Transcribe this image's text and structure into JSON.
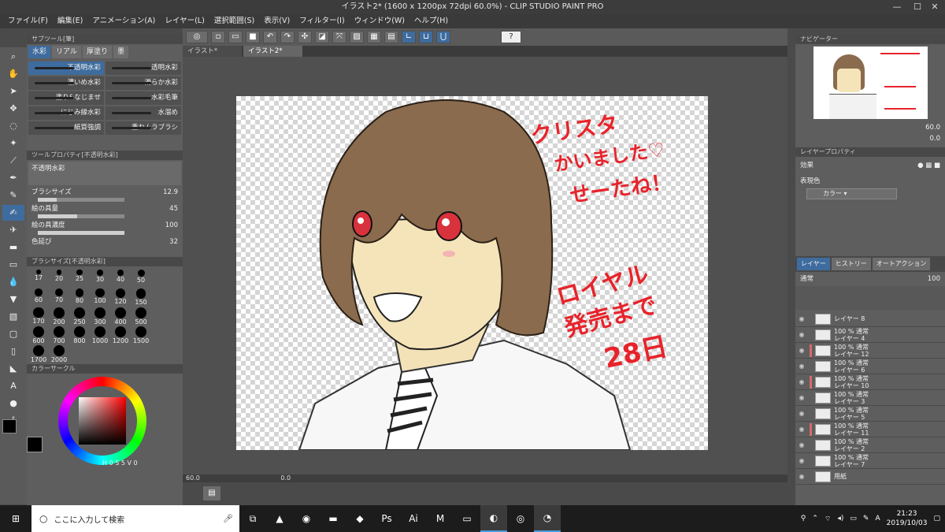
{
  "window": {
    "title": "イラスト2* (1600 x 1200px 72dpi 60.0%) - CLIP STUDIO PAINT PRO",
    "min": "—",
    "max": "☐",
    "close": "✕"
  },
  "menu": [
    "ファイル(F)",
    "編集(E)",
    "アニメーション(A)",
    "レイヤー(L)",
    "選択範囲(S)",
    "表示(V)",
    "フィルター(I)",
    "ウィンドウ(W)",
    "ヘルプ(H)"
  ],
  "toolbar": {
    "help": "?"
  },
  "subtool": {
    "header": "サブツール[筆]",
    "tabs": [
      "水彩",
      "リアル",
      "厚塗り",
      "墨"
    ],
    "brushes": [
      [
        "不透明水彩",
        "透明水彩"
      ],
      [
        "濃いめ水彩",
        "滑らか水彩"
      ],
      [
        "塗り&なじませ",
        "水彩毛筆"
      ],
      [
        "にじみ縁水彩",
        "水溜め"
      ],
      [
        "紙質強調",
        "重ねムラブラシ"
      ]
    ]
  },
  "toolprop": {
    "header": "ツールプロパティ[不透明水彩]",
    "name": "不透明水彩",
    "props": [
      {
        "label": "ブラシサイズ",
        "value": "12.9",
        "fill": 0.22
      },
      {
        "label": "絵の具量",
        "value": "45",
        "fill": 0.45
      },
      {
        "label": "絵の具濃度",
        "value": "100",
        "fill": 1.0
      },
      {
        "label": "色延び",
        "value": "32",
        "fill": 0.32
      }
    ]
  },
  "brushsize": {
    "header": "ブラシサイズ[不透明水彩]",
    "sizes": [
      "17",
      "20",
      "25",
      "30",
      "40",
      "50",
      "60",
      "70",
      "80",
      "100",
      "120",
      "150",
      "170",
      "200",
      "250",
      "300",
      "400",
      "500",
      "600",
      "700",
      "800",
      "1000",
      "1200",
      "1500",
      "1700",
      "2000"
    ]
  },
  "colorcircle": {
    "header": "カラーサークル",
    "readout": [
      "H",
      "0",
      "S",
      "5",
      "V",
      "0"
    ]
  },
  "doctabs": [
    "イラスト*",
    "イラスト2*"
  ],
  "status": {
    "zoom": "60.0",
    "angle": "0.0"
  },
  "navigator": {
    "header": "ナビゲーター",
    "zoom": "60.0",
    "angle": "0.0"
  },
  "layerprop": {
    "header": "レイヤープロパティ",
    "effect": "効果",
    "expr": "表現色",
    "color_mode": "カラー"
  },
  "layers": {
    "tabs": [
      "レイヤー",
      "ヒストリー",
      "オートアクション"
    ],
    "blend": "通常",
    "opacity": "100",
    "items": [
      {
        "mode": "",
        "name": "レイヤー 8",
        "marked": false
      },
      {
        "mode": "100 % 通常",
        "name": "レイヤー 4",
        "marked": false
      },
      {
        "mode": "100 % 通常",
        "name": "レイヤー 12",
        "marked": true
      },
      {
        "mode": "100 % 通常",
        "name": "レイヤー 6",
        "marked": false
      },
      {
        "mode": "100 % 通常",
        "name": "レイヤー 10",
        "marked": true
      },
      {
        "mode": "100 % 通常",
        "name": "レイヤー 3",
        "marked": false
      },
      {
        "mode": "100 % 通常",
        "name": "レイヤー 5",
        "marked": false
      },
      {
        "mode": "100 % 通常",
        "name": "レイヤー 11",
        "marked": true
      },
      {
        "mode": "100 % 通常",
        "name": "レイヤー 2",
        "marked": false
      },
      {
        "mode": "100 % 通常",
        "name": "レイヤー 7",
        "marked": false
      },
      {
        "mode": "",
        "name": "用紙",
        "marked": false
      }
    ]
  },
  "artwork": {
    "text1": [
      "クリスタ",
      "かいました♡",
      "せーたね！"
    ],
    "text2": [
      "ロイヤル",
      "発売まで",
      "28日"
    ]
  },
  "taskbar": {
    "search": "ここに入力して検索",
    "time": "21:23",
    "date": "2019/10/03",
    "ime": "A"
  },
  "colors": {
    "accent": "#3e6c9e",
    "text_red": "#e8232b",
    "hair": "#8a6b4e",
    "eye": "#d8323c"
  }
}
